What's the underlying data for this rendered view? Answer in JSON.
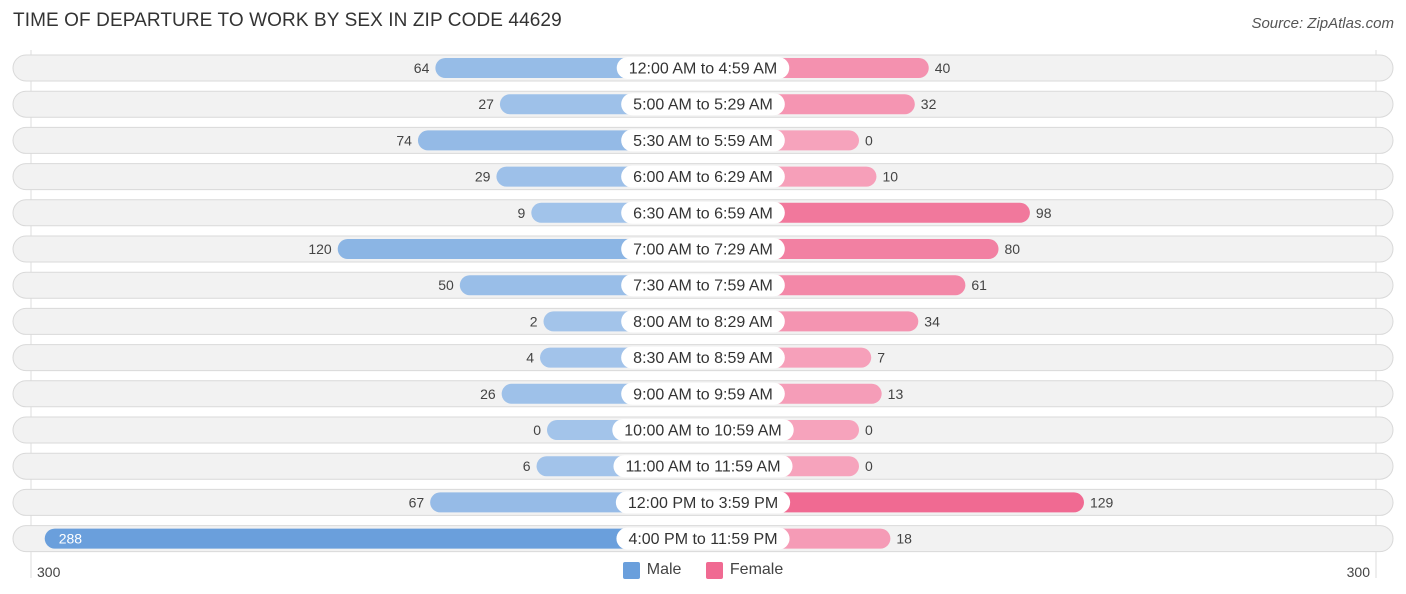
{
  "title": "TIME OF DEPARTURE TO WORK BY SEX IN ZIP CODE 44629",
  "source": "Source: ZipAtlas.com",
  "colors": {
    "male": "#6a9fdc",
    "male_light": "#a3c4ea",
    "female": "#f06a92",
    "female_light": "#f6a3bc"
  },
  "chart_data": {
    "type": "bar",
    "orientation": "horizontal-diverging",
    "title": "TIME OF DEPARTURE TO WORK BY SEX IN ZIP CODE 44629",
    "categories": [
      "12:00 AM to 4:59 AM",
      "5:00 AM to 5:29 AM",
      "5:30 AM to 5:59 AM",
      "6:00 AM to 6:29 AM",
      "6:30 AM to 6:59 AM",
      "7:00 AM to 7:29 AM",
      "7:30 AM to 7:59 AM",
      "8:00 AM to 8:29 AM",
      "8:30 AM to 8:59 AM",
      "9:00 AM to 9:59 AM",
      "10:00 AM to 10:59 AM",
      "11:00 AM to 11:59 AM",
      "12:00 PM to 3:59 PM",
      "4:00 PM to 11:59 PM"
    ],
    "series": [
      {
        "name": "Male",
        "values": [
          64,
          27,
          74,
          29,
          9,
          120,
          50,
          2,
          4,
          26,
          0,
          6,
          67,
          288
        ]
      },
      {
        "name": "Female",
        "values": [
          40,
          32,
          0,
          10,
          98,
          80,
          61,
          34,
          7,
          13,
          0,
          0,
          129,
          18
        ]
      }
    ],
    "axis": {
      "left_label": "300",
      "right_label": "300",
      "range": [
        0,
        300
      ]
    },
    "legend": {
      "position": "bottom-center",
      "items": [
        "Male",
        "Female"
      ]
    }
  }
}
